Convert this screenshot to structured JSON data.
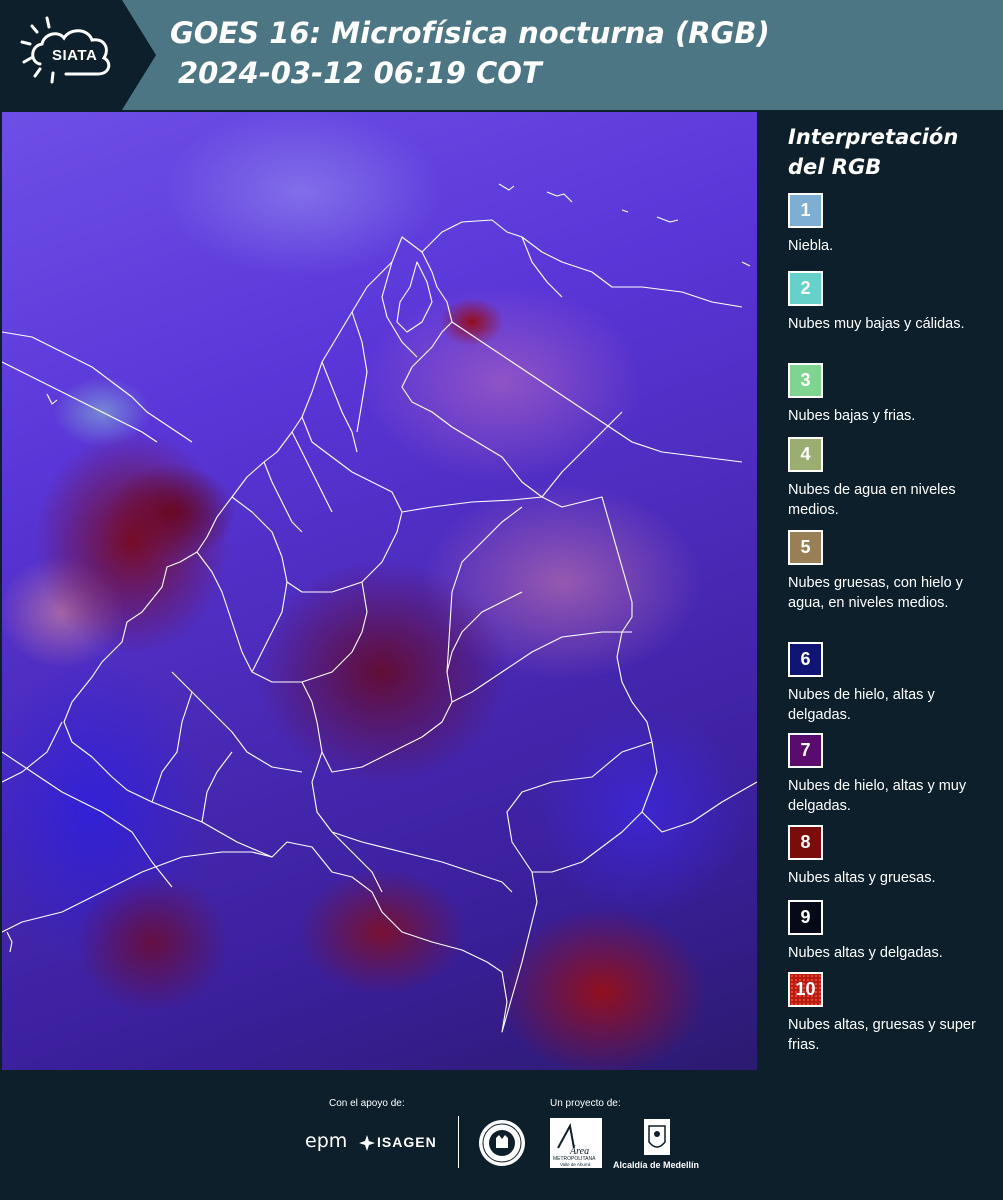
{
  "header": {
    "logo_text": "SIATA",
    "title_line1": "GOES 16: Microfísica nocturna (RGB)",
    "title_line2": "2024-03-12 06:19 COT",
    "background_color": "#4d7684"
  },
  "legend": {
    "title_line1": "Interpretación",
    "title_line2": "del RGB",
    "items": [
      {
        "number": "1",
        "color": "#7eaed4",
        "label": "Niebla."
      },
      {
        "number": "2",
        "color": "#66d1c8",
        "label": "Nubes muy bajas y cálidas."
      },
      {
        "number": "3",
        "color": "#7fd48f",
        "label": "Nubes bajas y frias."
      },
      {
        "number": "4",
        "color": "#9aae72",
        "label": "Nubes de agua en niveles medios."
      },
      {
        "number": "5",
        "color": "#987f55",
        "label": "Nubes gruesas, con hielo y agua, en niveles medios."
      },
      {
        "number": "6",
        "color": "#0f1475",
        "label": "Nubes de hielo, altas y delgadas."
      },
      {
        "number": "7",
        "color": "#5a0c6e",
        "label": "Nubes de hielo, altas y muy delgadas."
      },
      {
        "number": "8",
        "color": "#7a0c0c",
        "label": "Nubes altas y gruesas."
      },
      {
        "number": "9",
        "color": "#050a18",
        "label": "Nubes altas y delgadas."
      },
      {
        "number": "10",
        "color": "#b81c10",
        "label": "Nubes altas, gruesas y super frias."
      }
    ]
  },
  "footer": {
    "support_label": "Con el apoyo de:",
    "project_label": "Un proyecto de:",
    "sponsor_epm": "epm",
    "sponsor_isagen": "ISAGEN",
    "area_logo_text": "Área",
    "area_logo_subtext": "METROPOLITANA",
    "area_logo_subtext2": "Valle de Aburrá",
    "alcaldia_label": "Alcaldía de Medellín"
  }
}
